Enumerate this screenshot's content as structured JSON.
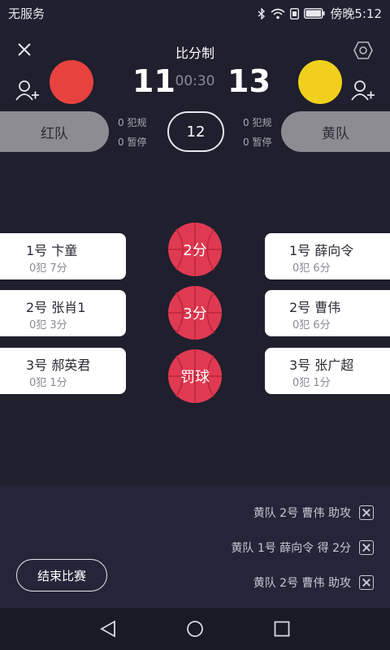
{
  "status": {
    "carrier": "无服务",
    "time": "傍晚5:12"
  },
  "header": {
    "title": "比分制",
    "score_red": "11",
    "score_yellow": "13",
    "clock": "00:30"
  },
  "colors": {
    "red_team": "#e8423f",
    "yellow_team": "#f0d01d",
    "accent": "#e03a52"
  },
  "teams": {
    "red": {
      "name": "红队",
      "fouls": "0 犯规",
      "timeouts": "0 暂停"
    },
    "yellow": {
      "name": "黄队",
      "fouls": "0 犯规",
      "timeouts": "0 暂停"
    }
  },
  "period": "12",
  "red_players": [
    {
      "name": "1号 卞童",
      "stats": "0犯 7分"
    },
    {
      "name": "2号 张肖1",
      "stats": "0犯 3分"
    },
    {
      "name": "3号 郝英君",
      "stats": "0犯 1分"
    }
  ],
  "yellow_players": [
    {
      "name": "1号 薛向令",
      "stats": "0犯 6分"
    },
    {
      "name": "2号 曹伟",
      "stats": "0犯 6分"
    },
    {
      "name": "3号 张广超",
      "stats": "0犯 1分"
    }
  ],
  "actions": {
    "two": "2分",
    "three": "3分",
    "free": "罚球"
  },
  "log": [
    "黄队 2号 曹伟 助攻",
    "黄队 1号 薛向令 得 2分",
    "黄队 2号 曹伟 助攻"
  ],
  "end_button": "结束比赛",
  "icons": [
    "close-icon",
    "settings-icon",
    "add-player-icon",
    "back-icon",
    "home-icon",
    "recents-icon"
  ]
}
